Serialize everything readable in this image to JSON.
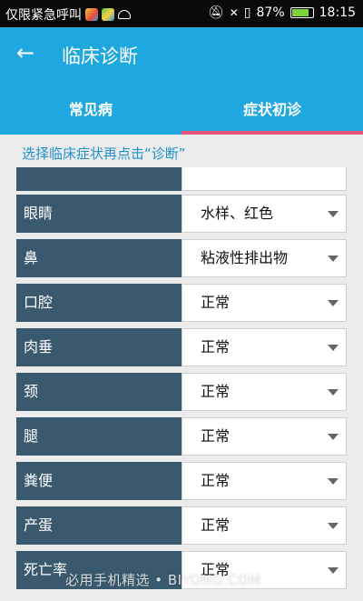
{
  "status_bar": {
    "notification_text": "仅限紧急呼叫",
    "battery_percent": "87%",
    "time": "18:15",
    "battery_level": 0.87
  },
  "app_bar": {
    "title": "临床诊断"
  },
  "tabs": [
    {
      "label": "常见病",
      "active": false
    },
    {
      "label": "症状初诊",
      "active": true
    }
  ],
  "hint": "选择临床症状再点击“诊断”",
  "symptoms": [
    {
      "label": "眼睛",
      "value": "水样、红色"
    },
    {
      "label": "鼻",
      "value": "粘液性排出物"
    },
    {
      "label": "口腔",
      "value": "正常"
    },
    {
      "label": "肉垂",
      "value": "正常"
    },
    {
      "label": "颈",
      "value": "正常"
    },
    {
      "label": "腿",
      "value": "正常"
    },
    {
      "label": "粪便",
      "value": "正常"
    },
    {
      "label": "产蛋",
      "value": "正常"
    },
    {
      "label": "死亡率",
      "value": "正常"
    }
  ],
  "watermark": "必用手机精选 • BIYONG.COM",
  "colors": {
    "primary": "#1fa8e0",
    "tab_indicator": "#e8557a",
    "label_bg": "#39596e",
    "hint": "#1f8fd0"
  }
}
